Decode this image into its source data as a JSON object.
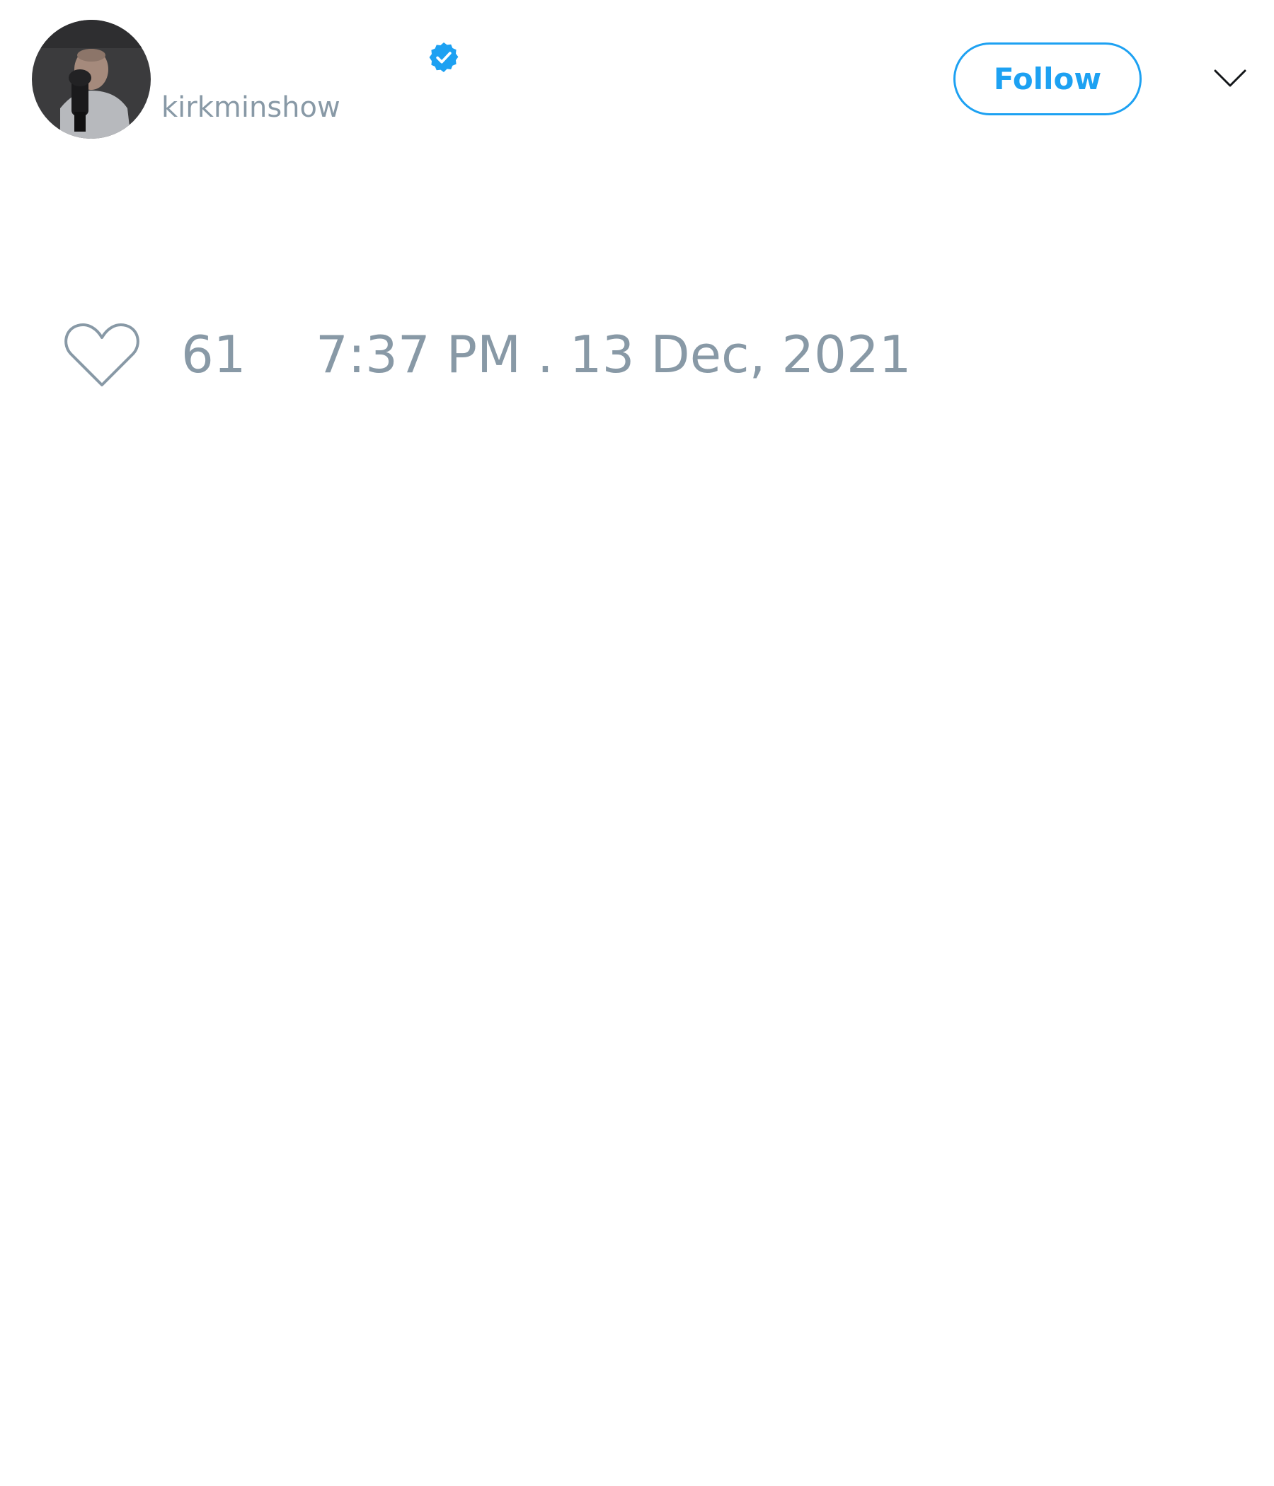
{
  "author": {
    "display_name": "",
    "handle": "kirkminshow",
    "verified": true,
    "avatar_alt": "profile photo"
  },
  "header": {
    "follow_label": "Follow",
    "menu_icon": "chevron-down-icon"
  },
  "tweet": {
    "like_count": "61",
    "timestamp": "7:37 PM . 13 Dec, 2021"
  },
  "colors": {
    "accent": "#1da1f2",
    "muted_text": "#8899a6",
    "heart_outline": "#8899a6"
  }
}
